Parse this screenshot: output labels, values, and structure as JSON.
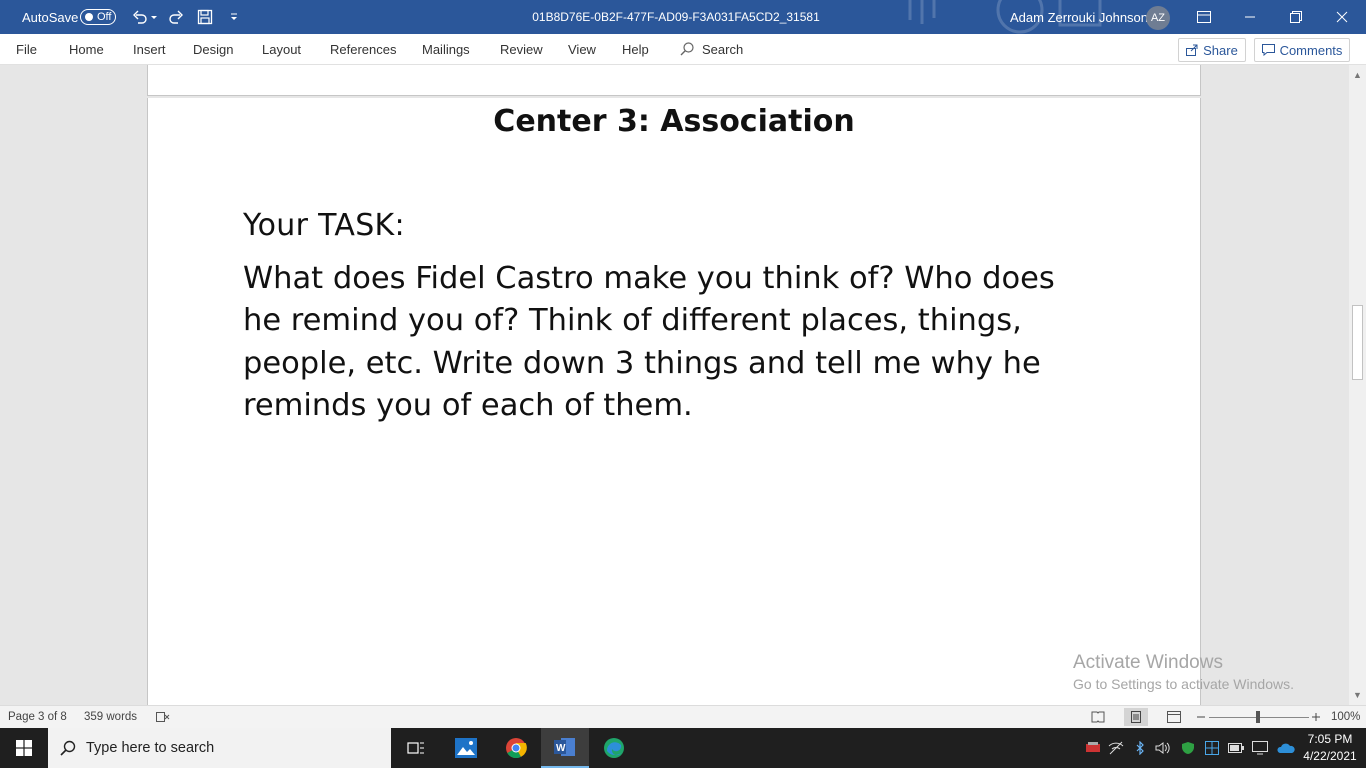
{
  "titlebar": {
    "autosave_label": "AutoSave",
    "autosave_state": "Off",
    "document_title": "01B8D76E-0B2F-477F-AD09-F3A031FA5CD2_31581",
    "user_name": "Adam Zerrouki Johnson",
    "user_initials": "AZ"
  },
  "ribbon": {
    "tabs": [
      "File",
      "Home",
      "Insert",
      "Design",
      "Layout",
      "References",
      "Mailings",
      "Review",
      "View",
      "Help"
    ],
    "search_label": "Search",
    "share_label": "Share",
    "comments_label": "Comments"
  },
  "document": {
    "heading": "Center 3: Association",
    "task_label": "Your TASK:",
    "task_body": "What does Fidel Castro make you think of? Who does he remind you of? Think of different places, things, people, etc. Write down 3 things and tell me why he reminds you of each of them."
  },
  "watermark": {
    "line1": "Activate Windows",
    "line2": "Go to Settings to activate Windows."
  },
  "statusbar": {
    "page": "Page 3 of 8",
    "words": "359 words",
    "zoom": "100%"
  },
  "taskbar": {
    "search_placeholder": "Type here to search",
    "time": "7:05 PM",
    "date": "4/22/2021"
  },
  "colors": {
    "word_blue": "#2b579a",
    "taskbar": "#1f1f1f"
  }
}
